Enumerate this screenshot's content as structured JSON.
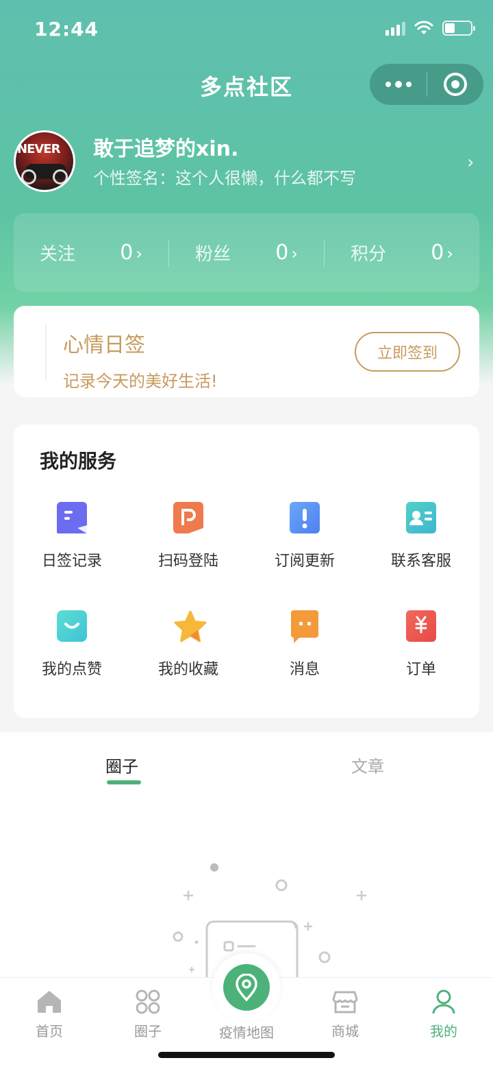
{
  "status_bar": {
    "time": "12:44"
  },
  "nav": {
    "title": "多点社区"
  },
  "profile": {
    "name": "敢于追梦的xin.",
    "signature": "个性签名：这个人很懒，什么都不写",
    "avatar_text": "NEVER"
  },
  "stats": [
    {
      "label": "关注",
      "value": "0"
    },
    {
      "label": "粉丝",
      "value": "0"
    },
    {
      "label": "积分",
      "value": "0"
    }
  ],
  "mood": {
    "title": "心情日签",
    "subtitle": "记录今天的美好生活!",
    "button": "立即签到"
  },
  "services": {
    "title": "我的服务",
    "items": [
      {
        "label": "日签记录",
        "icon": "calendar-record-icon",
        "color": "#6b6cf0"
      },
      {
        "label": "扫码登陆",
        "icon": "scan-login-icon",
        "color": "#ef7a4e"
      },
      {
        "label": "订阅更新",
        "icon": "subscribe-update-icon",
        "color": "#5b8ff0"
      },
      {
        "label": "联系客服",
        "icon": "contact-service-icon",
        "color": "#4ec9c4"
      },
      {
        "label": "我的点赞",
        "icon": "like-smile-icon",
        "color": "#4cd0d0"
      },
      {
        "label": "我的收藏",
        "icon": "star-icon",
        "color": "#f6b73a"
      },
      {
        "label": "消息",
        "icon": "message-icon",
        "color": "#f39a3a"
      },
      {
        "label": "订单",
        "icon": "order-yen-icon",
        "color": "#ee5b4b"
      }
    ]
  },
  "tabs": [
    {
      "label": "圈子",
      "active": true
    },
    {
      "label": "文章",
      "active": false
    }
  ],
  "tabbar": {
    "items": [
      {
        "label": "首页",
        "icon": "home-icon"
      },
      {
        "label": "圈子",
        "icon": "circle-group-icon"
      },
      {
        "label": "疫情地图",
        "icon": "map-pin-icon"
      },
      {
        "label": "商城",
        "icon": "shop-icon"
      },
      {
        "label": "我的",
        "icon": "user-icon",
        "active": true
      }
    ]
  },
  "colors": {
    "primary_green": "#4cb27a",
    "header_teal": "#5fbfae",
    "gold": "#c79a5e"
  }
}
